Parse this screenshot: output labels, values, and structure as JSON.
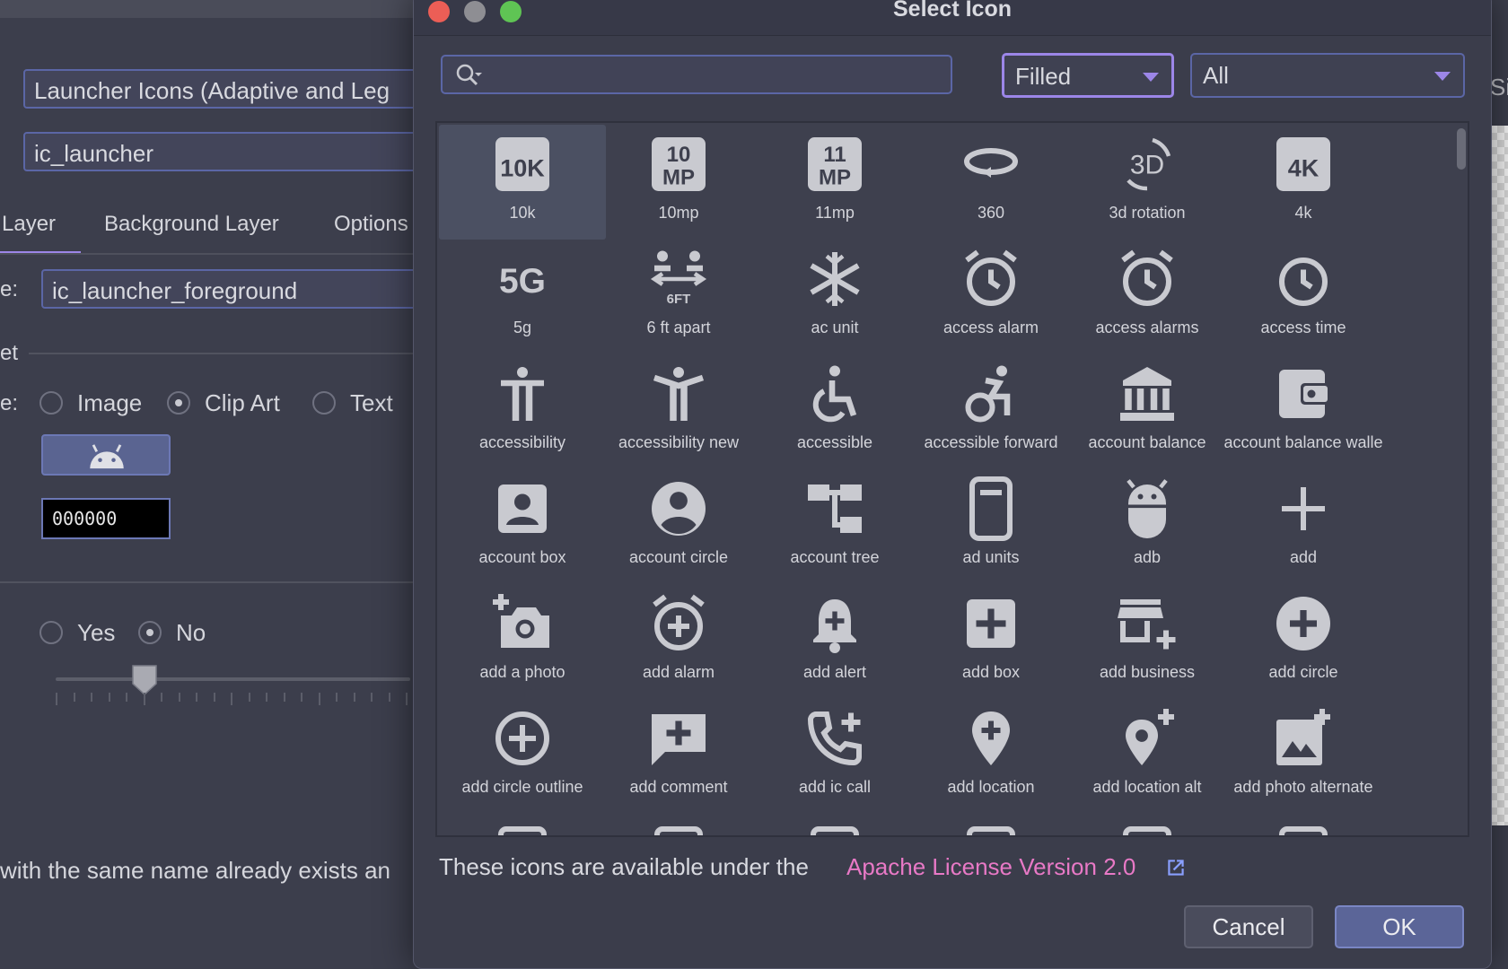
{
  "background_window": {
    "icon_type": "Launcher Icons (Adaptive and Leg",
    "name": "ic_launcher",
    "tabs": [
      "Layer",
      "Background Layer",
      "Options"
    ],
    "layer_name_label": "e:",
    "layer_name": "ic_launcher_foreground",
    "section_label": "et",
    "asset_type_label": "e:",
    "asset_types": [
      "Image",
      "Clip Art",
      "Text"
    ],
    "asset_type_selected": "Clip Art",
    "color": "000000",
    "trim_options": [
      "Yes",
      "No"
    ],
    "trim_selected": "No",
    "warning": "with the same name already exists an",
    "right_edge_char": "Si"
  },
  "dialog": {
    "title": "Select Icon",
    "search": {
      "value": "",
      "placeholder": ""
    },
    "style_dropdown": "Filled",
    "category_dropdown": "All",
    "icons": [
      {
        "label": "10k",
        "icon": "10k-icon"
      },
      {
        "label": "10mp",
        "icon": "10mp-icon"
      },
      {
        "label": "11mp",
        "icon": "11mp-icon"
      },
      {
        "label": "360",
        "icon": "360-icon"
      },
      {
        "label": "3d rotation",
        "icon": "3d-rotation-icon"
      },
      {
        "label": "4k",
        "icon": "4k-icon"
      },
      {
        "label": "5g",
        "icon": "5g-icon"
      },
      {
        "label": "6 ft apart",
        "icon": "6-ft-apart-icon"
      },
      {
        "label": "ac unit",
        "icon": "ac-unit-icon"
      },
      {
        "label": "access alarm",
        "icon": "access-alarm-icon"
      },
      {
        "label": "access alarms",
        "icon": "access-alarms-icon"
      },
      {
        "label": "access time",
        "icon": "access-time-icon"
      },
      {
        "label": "accessibility",
        "icon": "accessibility-icon"
      },
      {
        "label": "accessibility new",
        "icon": "accessibility-new-icon"
      },
      {
        "label": "accessible",
        "icon": "accessible-icon"
      },
      {
        "label": "accessible forward",
        "icon": "accessible-forward-icon"
      },
      {
        "label": "account balance",
        "icon": "account-balance-icon"
      },
      {
        "label": "account balance walle",
        "icon": "account-balance-wallet-icon"
      },
      {
        "label": "account box",
        "icon": "account-box-icon"
      },
      {
        "label": "account circle",
        "icon": "account-circle-icon"
      },
      {
        "label": "account tree",
        "icon": "account-tree-icon"
      },
      {
        "label": "ad units",
        "icon": "ad-units-icon"
      },
      {
        "label": "adb",
        "icon": "adb-icon"
      },
      {
        "label": "add",
        "icon": "add-icon"
      },
      {
        "label": "add a photo",
        "icon": "add-a-photo-icon"
      },
      {
        "label": "add alarm",
        "icon": "add-alarm-icon"
      },
      {
        "label": "add alert",
        "icon": "add-alert-icon"
      },
      {
        "label": "add box",
        "icon": "add-box-icon"
      },
      {
        "label": "add business",
        "icon": "add-business-icon"
      },
      {
        "label": "add circle",
        "icon": "add-circle-icon"
      },
      {
        "label": "add circle outline",
        "icon": "add-circle-outline-icon"
      },
      {
        "label": "add comment",
        "icon": "add-comment-icon"
      },
      {
        "label": "add ic call",
        "icon": "add-ic-call-icon"
      },
      {
        "label": "add location",
        "icon": "add-location-icon"
      },
      {
        "label": "add location alt",
        "icon": "add-location-alt-icon"
      },
      {
        "label": "add photo alternate",
        "icon": "add-photo-alternate-icon"
      }
    ],
    "selected_icon": "10k",
    "license_text": "These icons are available under the",
    "license_link": "Apache License Version 2.0",
    "cancel_label": "Cancel",
    "ok_label": "OK",
    "colors": {
      "accent": "#9c86e8",
      "link": "#e879c6",
      "close": "#ec5e56",
      "minimize": "#8e8e93",
      "maximize": "#5fc454"
    }
  }
}
